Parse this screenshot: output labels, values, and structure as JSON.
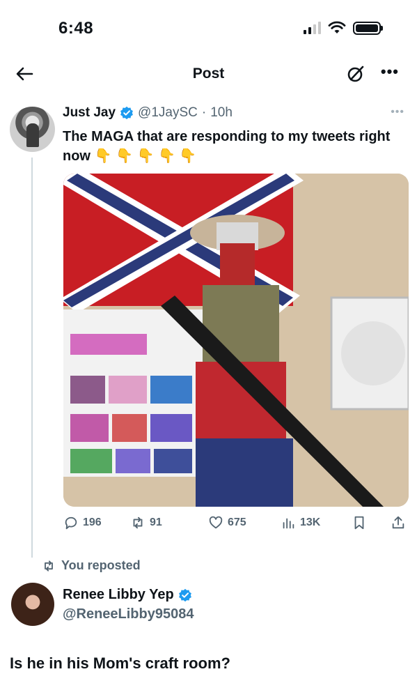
{
  "status_bar": {
    "time": "6:48",
    "icons": [
      "signal-icon",
      "wifi-icon",
      "battery-icon"
    ]
  },
  "header": {
    "title": "Post",
    "back_icon": "back-arrow-icon",
    "grok_icon": "grok-icon",
    "more_icon": "more-icon",
    "more_label": "•••"
  },
  "tweet": {
    "display_name": "Just Jay",
    "handle": "@1JaySC",
    "separator": "·",
    "time": "10h",
    "text": "The MAGA that are responding to my tweets right now",
    "emojis": "👇 👇 👇 👇 👇",
    "more_label": "•••",
    "media_description_icon": "photo",
    "stats": {
      "replies": "196",
      "reposts": "91",
      "likes": "675",
      "views": "13K"
    }
  },
  "repost_banner": {
    "label": "You reposted"
  },
  "reply": {
    "display_name": "Renee Libby Yep",
    "handle": "@ReneeLibby95084",
    "text": "Is he in his Mom's craft room?"
  },
  "colors": {
    "accent_blue": "#1d9bf0",
    "muted_text": "#536471",
    "thread_line": "#cfd9de",
    "text": "#0f1419"
  }
}
